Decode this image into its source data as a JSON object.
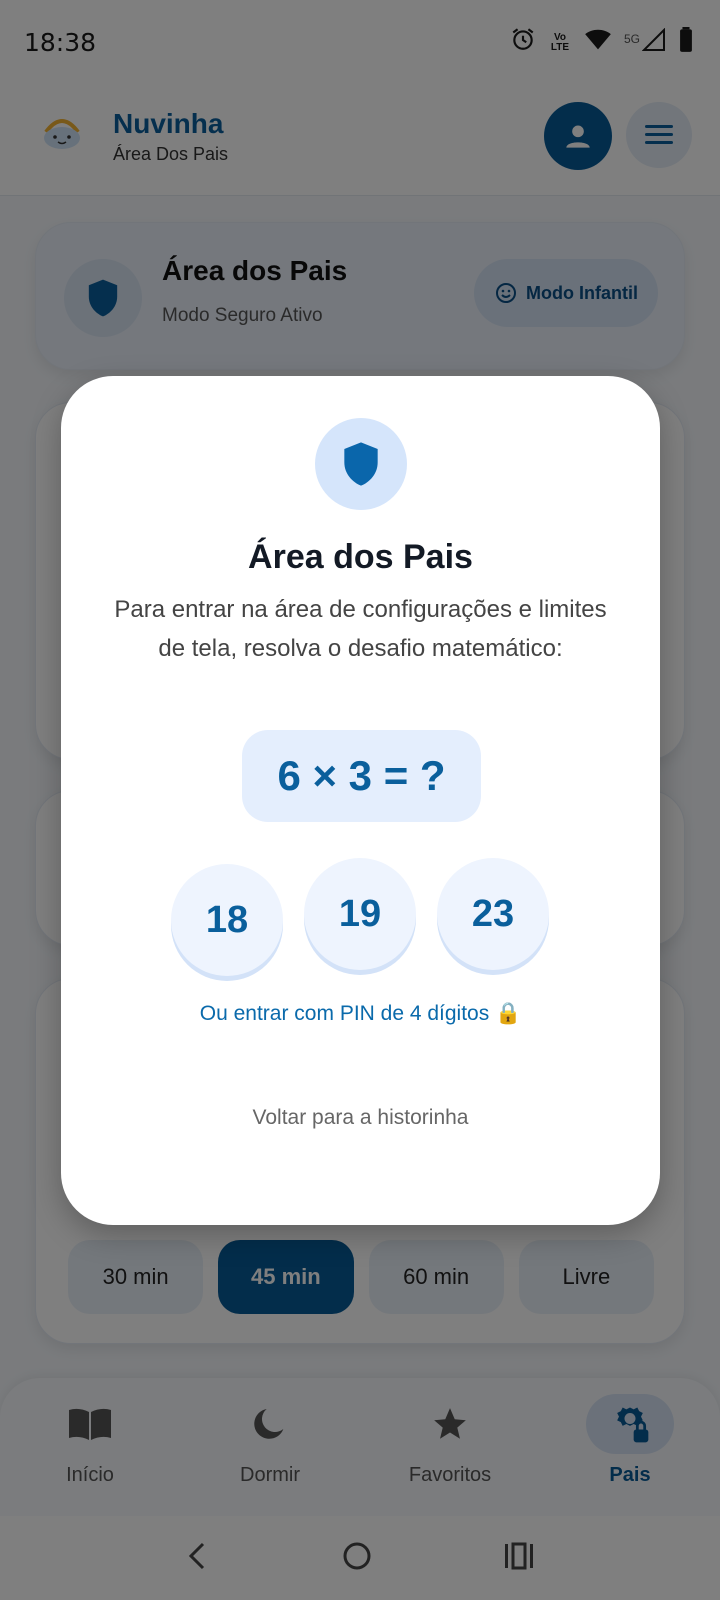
{
  "status": {
    "time": "18:38",
    "network_badge": "5G",
    "volte_label": "Vo\nLTE"
  },
  "header": {
    "title": "Nuvinha",
    "subtitle": "Área Dos Pais"
  },
  "parents_card": {
    "title": "Área dos Pais",
    "subtitle": "Modo Seguro Ativo",
    "mode_button": "Modo Infantil"
  },
  "time_limits": {
    "options": [
      "30 min",
      "45 min",
      "60 min",
      "Livre"
    ],
    "selected": "45 min"
  },
  "bottom_nav": {
    "items": [
      {
        "label": "Início",
        "icon": "book-icon"
      },
      {
        "label": "Dormir",
        "icon": "moon-icon"
      },
      {
        "label": "Favoritos",
        "icon": "star-icon"
      },
      {
        "label": "Pais",
        "icon": "gear-lock-icon"
      }
    ],
    "active": "Pais"
  },
  "dialog": {
    "title": "Área dos Pais",
    "text": "Para entrar na área de configurações e limites de tela, resolva o desafio matemático:",
    "equation": "6 × 3 = ?",
    "answers": [
      "18",
      "19",
      "23"
    ],
    "pin_link": "Ou entrar com PIN de 4 dígitos 🔒",
    "back_link": "Voltar para a historinha"
  },
  "colors": {
    "primary": "#075a96",
    "accent_light": "#e4eefd",
    "scrim": "rgba(0,0,0,0.5)"
  }
}
